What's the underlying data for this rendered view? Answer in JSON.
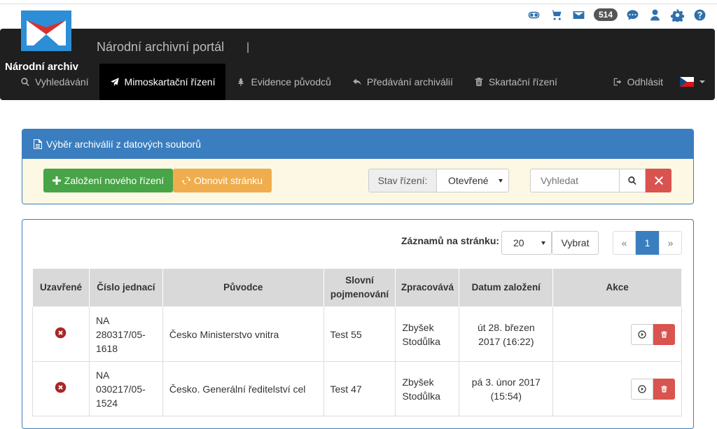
{
  "header": {
    "logo_text": "Národní archiv",
    "brand": "Národní archivní portál",
    "brand_separator": "|",
    "notification_count": "514",
    "top_icons": [
      "toggle-icon",
      "cart-icon",
      "envelope-icon",
      "comments-icon",
      "user-icon",
      "gear-icon",
      "help-icon"
    ]
  },
  "nav": {
    "items": [
      {
        "label": "Vyhledávání",
        "icon": "search-icon"
      },
      {
        "label": "Mimoskartační řízení",
        "icon": "paper-plane-icon",
        "active": true
      },
      {
        "label": "Evidence původců",
        "icon": "tree-icon"
      },
      {
        "label": "Předávání archiválií",
        "icon": "reply-icon"
      },
      {
        "label": "Skartační řízení",
        "icon": "trash-icon"
      }
    ],
    "logout": "Odhlásit",
    "language": "cs"
  },
  "filter_panel": {
    "title": "Výběr archiválií z datových souborů",
    "new_button": "Založení nového řízení",
    "refresh_button": "Obnovit stránku",
    "state_label": "Stav řízení:",
    "state_value": "Otevřené",
    "search_placeholder": "Vyhledat"
  },
  "list_panel": {
    "per_page_label": "Záznamů na stránku:",
    "per_page_value": "20",
    "select_button": "Vybrat",
    "pager": {
      "prev": "«",
      "current": "1",
      "next": "»"
    },
    "columns": [
      "Uzavřené",
      "Číslo jednací",
      "Původce",
      "Slovní pojmenování",
      "Zpracovává",
      "Datum založení",
      "Akce"
    ],
    "rows": [
      {
        "closed": false,
        "number": "NA 280317/05-1618",
        "originator": "Česko Ministerstvo vnitra",
        "name": "Test 55",
        "processor": "Zbyšek Stodůlka",
        "date": "út 28. březen 2017 (16:22)"
      },
      {
        "closed": false,
        "number": "NA 030217/05-1524",
        "originator": "Česko. Generální ředitelství cel",
        "name": "Test 47",
        "processor": "Zbyšek Stodůlka",
        "date": "pá 3. únor 2017 (15:54)"
      }
    ]
  },
  "colors": {
    "navbar": "#1f1f1f",
    "primary": "#3a7ebf",
    "success": "#47a447",
    "warning": "#f0ad4e",
    "danger": "#d9534f",
    "panel_body": "#fcf8e3"
  }
}
